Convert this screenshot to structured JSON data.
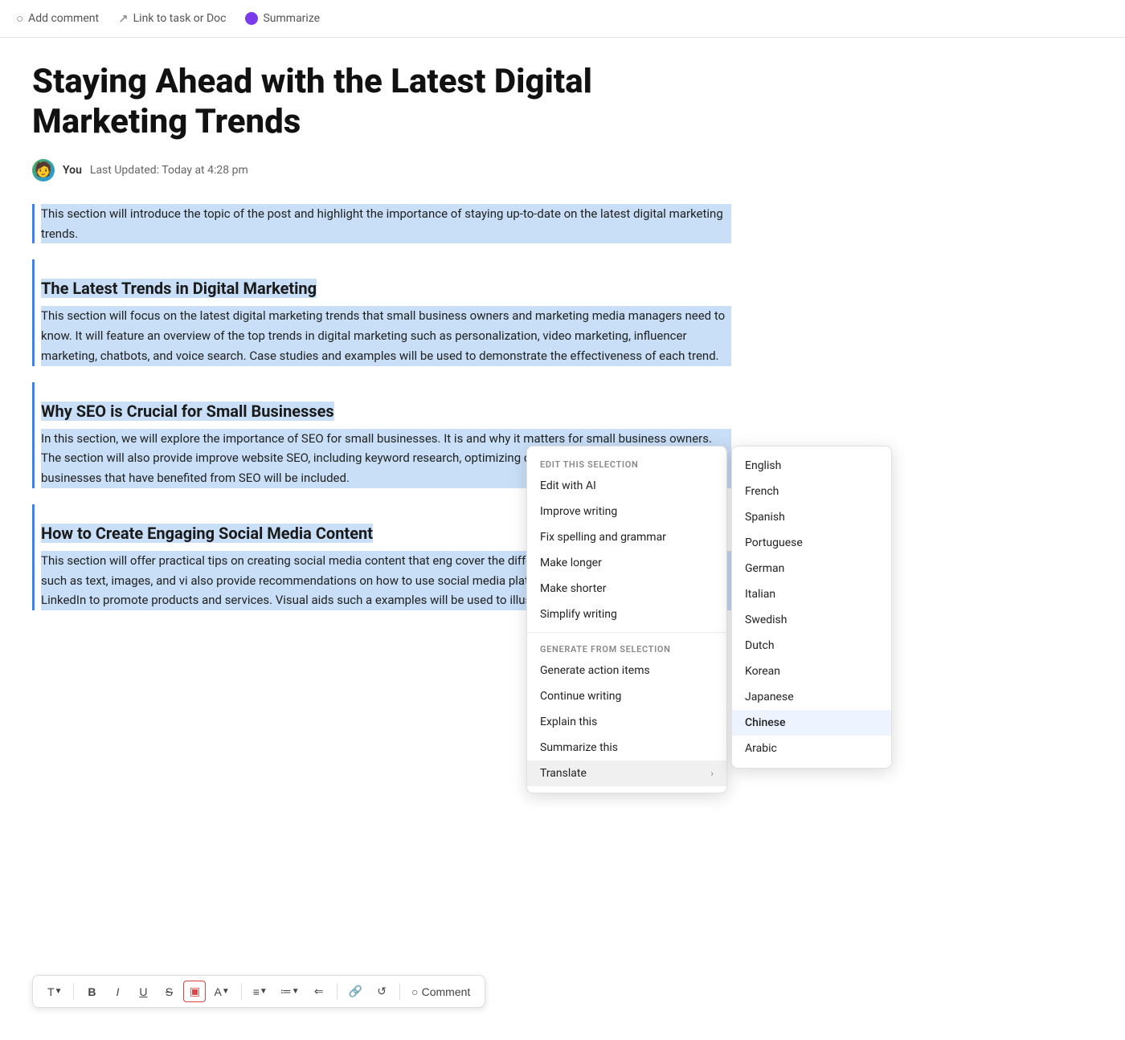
{
  "toolbar": {
    "add_comment": "Add comment",
    "link_to_task": "Link to task or Doc",
    "summarize": "Summarize"
  },
  "document": {
    "title": "Staying Ahead with the Latest Digital Marketing Trends",
    "author": "You",
    "last_updated": "Last Updated: Today at 4:28 pm",
    "sections": [
      {
        "id": "intro",
        "heading": null,
        "body": "This section will introduce the topic of the post and highlight the importance of staying up-to-date on the latest digital marketing trends."
      },
      {
        "id": "latest-trends",
        "heading": "The Latest Trends in Digital Marketing",
        "body": "This section will focus on the latest digital marketing trends that small business owners and marketing media managers need to know. It will feature an overview of the top trends in digital marketing such as personalization, video marketing, influencer marketing, chatbots, and voice search. Case studies and examples will be used to demonstrate the effectiveness of each trend."
      },
      {
        "id": "seo",
        "heading": "Why SEO is Crucial for Small Businesses",
        "body": "In this section, we will explore the importance of SEO for small businesses. It is and why it matters for small business owners. The section will also provide improve website SEO, including keyword research, optimizing content, and b Examples of small businesses that have benefited from SEO will be included."
      },
      {
        "id": "social-media",
        "heading": "How to Create Engaging Social Media Content",
        "body": "This section will offer practical tips on creating social media content that eng cover the different types of social media content such as text, images, and vi also provide recommendations on how to use social media platforms like Fac Instagram, and LinkedIn to promote products and services. Visual aids such a examples will be used to illustrate the best practices."
      }
    ]
  },
  "formatting_toolbar": {
    "text_btn": "T",
    "bold_btn": "B",
    "italic_btn": "I",
    "underline_btn": "U",
    "strikethrough_btn": "S",
    "highlight_btn": "▣",
    "color_btn": "A",
    "align_btn": "≡",
    "list_btn": "≔",
    "outdent_btn": "⇐",
    "link_btn": "🔗",
    "undo_btn": "↺",
    "comment_btn": "Comment"
  },
  "context_menu": {
    "section_label_edit": "EDIT THIS SELECTION",
    "section_label_generate": "GENERATE FROM SELECTION",
    "edit_items": [
      {
        "label": "Edit with AI",
        "arrow": false
      },
      {
        "label": "Improve writing",
        "arrow": false
      },
      {
        "label": "Fix spelling and grammar",
        "arrow": false
      },
      {
        "label": "Make longer",
        "arrow": false
      },
      {
        "label": "Make shorter",
        "arrow": false
      },
      {
        "label": "Simplify writing",
        "arrow": false
      }
    ],
    "generate_items": [
      {
        "label": "Generate action items",
        "arrow": false
      },
      {
        "label": "Continue writing",
        "arrow": false
      },
      {
        "label": "Explain this",
        "arrow": false
      },
      {
        "label": "Summarize this",
        "arrow": false
      },
      {
        "label": "Translate",
        "arrow": true
      }
    ]
  },
  "submenu": {
    "languages": [
      "English",
      "French",
      "Spanish",
      "Portuguese",
      "German",
      "Italian",
      "Swedish",
      "Dutch",
      "Korean",
      "Japanese",
      "Chinese",
      "Arabic"
    ],
    "highlighted": "Chinese"
  }
}
